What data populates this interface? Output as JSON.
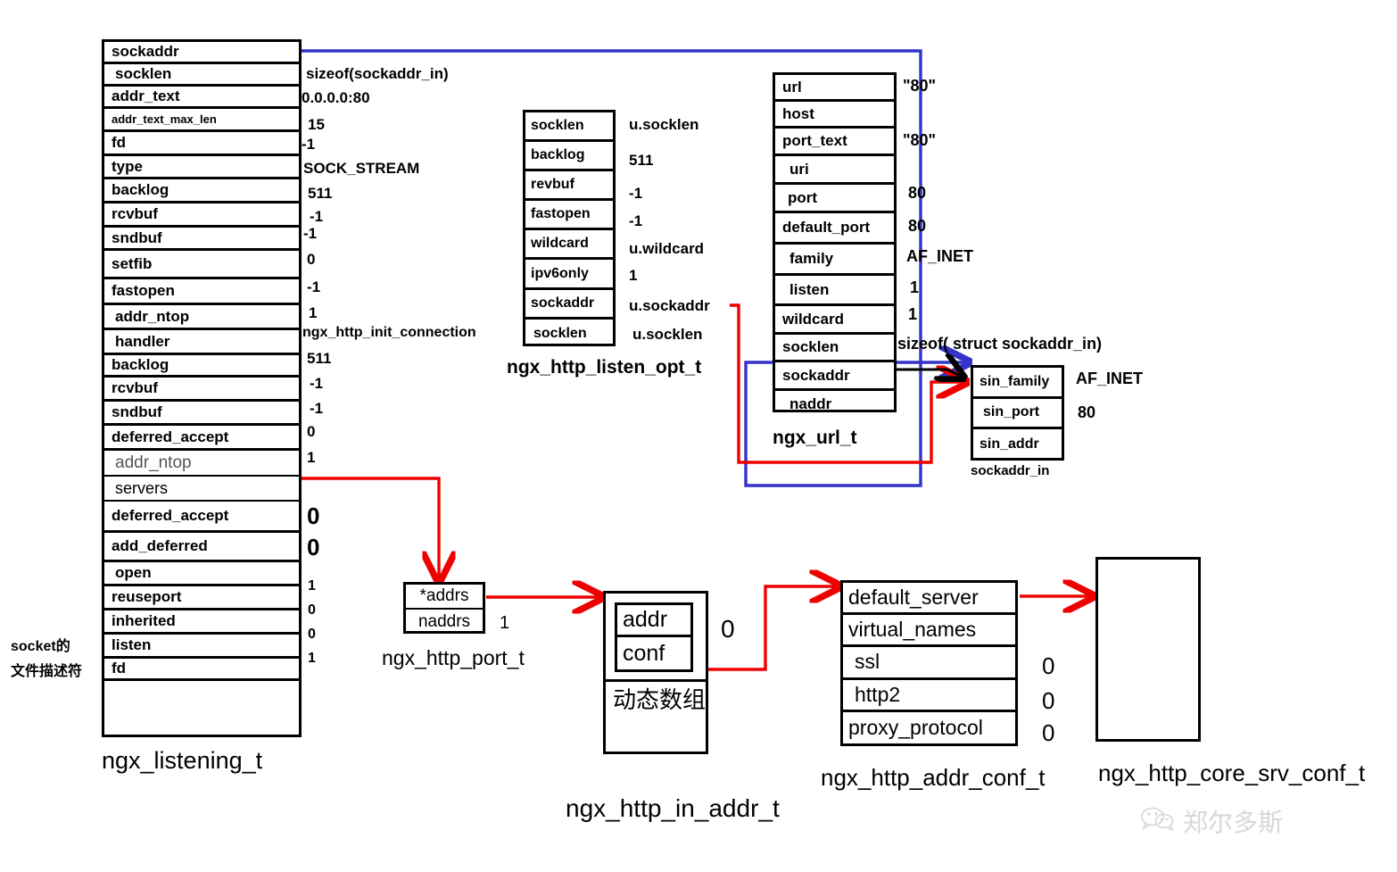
{
  "title": "nginx listening structures diagram",
  "colors": {
    "blue_wire": "#3333cc",
    "red_wire": "#ee0000",
    "black": "#000000",
    "watermark": "#d7d7d7"
  },
  "listening": {
    "caption": "ngx_listening_t",
    "side_note_line1": "socket的",
    "side_note_line2": "文件描述符",
    "fields": [
      {
        "name": "sockaddr",
        "value": ""
      },
      {
        "name": "socklen",
        "value": "sizeof(sockaddr_in)"
      },
      {
        "name": "addr_text",
        "value": "0.0.0.0:80"
      },
      {
        "name": "addr_text_max_len",
        "value": "15"
      },
      {
        "name": "fd",
        "value": "-1"
      },
      {
        "name": "type",
        "value": "SOCK_STREAM"
      },
      {
        "name": "backlog",
        "value": "511"
      },
      {
        "name": "rcvbuf",
        "value": "-1"
      },
      {
        "name": "sndbuf",
        "value": "-1"
      },
      {
        "name": "setfib",
        "value": "0"
      },
      {
        "name": "fastopen",
        "value": "-1"
      },
      {
        "name": "addr_ntop",
        "value": "1"
      },
      {
        "name": "handler",
        "value": "ngx_http_init_connection"
      },
      {
        "name": "backlog",
        "value": "511"
      },
      {
        "name": "rcvbuf",
        "value": "-1"
      },
      {
        "name": "sndbuf",
        "value": "-1"
      },
      {
        "name": "deferred_accept",
        "value": "0"
      },
      {
        "name": "addr_ntop",
        "value": "1"
      },
      {
        "name": "servers",
        "value": ""
      },
      {
        "name": "deferred_accept",
        "value": "0"
      },
      {
        "name": "add_deferred",
        "value": "0"
      },
      {
        "name": "open",
        "value": "1"
      },
      {
        "name": "reuseport",
        "value": "0"
      },
      {
        "name": "inherited",
        "value": "0"
      },
      {
        "name": "listen",
        "value": "1"
      },
      {
        "name": "fd",
        "value": ""
      },
      {
        "name": "",
        "value": ""
      }
    ]
  },
  "listen_opt": {
    "caption": "ngx_http_listen_opt_t",
    "fields": [
      {
        "name": "socklen",
        "value": "u.socklen"
      },
      {
        "name": "backlog",
        "value": "511"
      },
      {
        "name": "revbuf",
        "value": "-1"
      },
      {
        "name": "fastopen",
        "value": "-1"
      },
      {
        "name": "wildcard",
        "value": "u.wildcard"
      },
      {
        "name": "ipv6only",
        "value": "1"
      },
      {
        "name": "sockaddr",
        "value": "u.sockaddr"
      },
      {
        "name": "socklen",
        "value": "u.socklen"
      }
    ]
  },
  "url": {
    "caption": "ngx_url_t",
    "socklen_note": "sizeof( struct sockaddr_in)",
    "fields": [
      {
        "name": "url",
        "value": "\"80\""
      },
      {
        "name": "host",
        "value": ""
      },
      {
        "name": "port_text",
        "value": "\"80\""
      },
      {
        "name": "uri",
        "value": ""
      },
      {
        "name": "port",
        "value": "80"
      },
      {
        "name": "default_port",
        "value": "80"
      },
      {
        "name": "family",
        "value": "AF_INET"
      },
      {
        "name": "listen",
        "value": "1"
      },
      {
        "name": "wildcard",
        "value": "1"
      },
      {
        "name": "socklen",
        "value": ""
      },
      {
        "name": "sockaddr",
        "value": ""
      },
      {
        "name": "naddr",
        "value": ""
      }
    ]
  },
  "sockaddr_in": {
    "caption": "sockaddr_in",
    "fields": [
      {
        "name": "sin_family",
        "value": "AF_INET"
      },
      {
        "name": "sin_port",
        "value": "80"
      },
      {
        "name": "sin_addr",
        "value": ""
      }
    ]
  },
  "http_port": {
    "caption": "ngx_http_port_t",
    "fields": [
      {
        "name": "*addrs",
        "value": ""
      },
      {
        "name": "naddrs",
        "value": "1"
      }
    ]
  },
  "in_addr": {
    "caption": "ngx_http_in_addr_t",
    "dynamic_array_label": "动态数组",
    "fields": [
      {
        "name": "addr",
        "value": "0"
      },
      {
        "name": "conf",
        "value": ""
      }
    ]
  },
  "addr_conf": {
    "caption": "ngx_http_addr_conf_t",
    "fields": [
      {
        "name": "default_server",
        "value": ""
      },
      {
        "name": "virtual_names",
        "value": ""
      },
      {
        "name": "ssl",
        "value": "0"
      },
      {
        "name": "http2",
        "value": "0"
      },
      {
        "name": "proxy_protocol",
        "value": "0"
      }
    ]
  },
  "core_srv_conf": {
    "caption": "ngx_http_core_srv_conf_t"
  },
  "watermark": {
    "text": "郑尔多斯",
    "icon": "wechat-icon"
  }
}
